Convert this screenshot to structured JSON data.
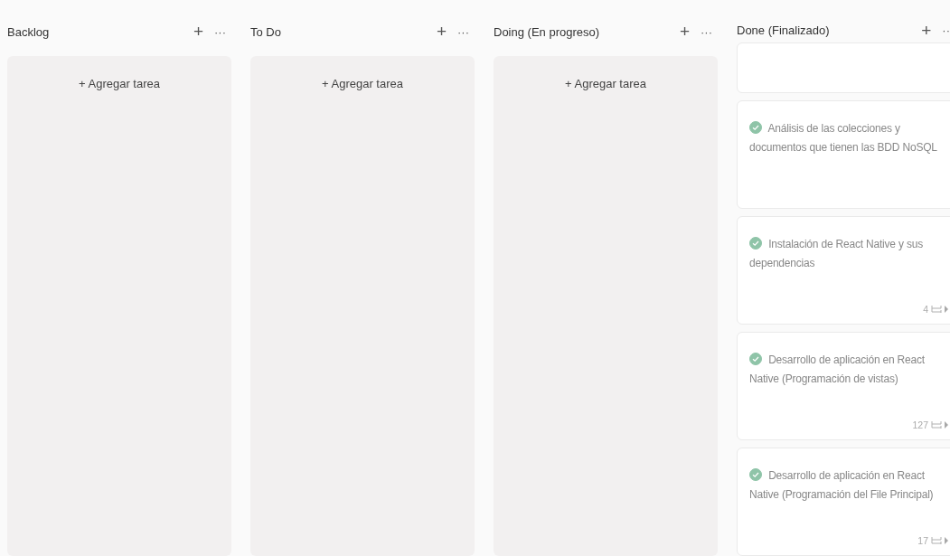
{
  "columns": [
    {
      "title": "Backlog",
      "add": "+",
      "more": "···",
      "add_task": "+ Agregar tarea"
    },
    {
      "title": "To Do",
      "add": "+",
      "more": "···",
      "add_task": "+ Agregar tarea"
    },
    {
      "title": "Doing (En progreso)",
      "add": "+",
      "more": "···",
      "add_task": "+ Agregar tarea"
    },
    {
      "title": "Done (Finalizado)",
      "add": "+",
      "more": "··",
      "cards": [
        {
          "kind": "clipped"
        },
        {
          "kind": "task",
          "completed": true,
          "title": "Análisis de las colecciones y documentos que tienen las BDD NoSQL"
        },
        {
          "kind": "task",
          "completed": true,
          "title": "Instalación de React Native y sus dependencias",
          "subtasks": "4"
        },
        {
          "kind": "task",
          "completed": true,
          "title": "Desarrollo de aplicación en React Native (Programación de vistas)",
          "subtasks": "127"
        },
        {
          "kind": "task",
          "completed": true,
          "title": "Desarrollo de aplicación en React Native (Programación del File Principal)",
          "subtasks": "17"
        }
      ]
    }
  ]
}
